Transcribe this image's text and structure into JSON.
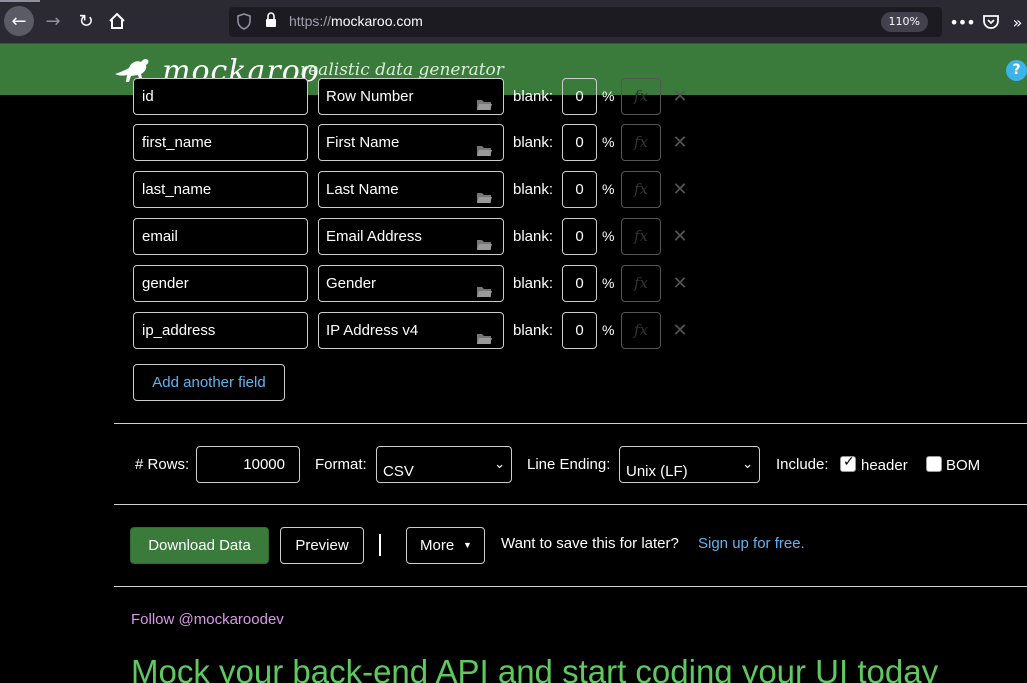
{
  "browser": {
    "url_prefix": "https://",
    "url_host": "mockaroo.com",
    "zoom": "110%"
  },
  "header": {
    "logo_text": "mockaroo",
    "tagline": "realistic data generator",
    "help": "?"
  },
  "fields": [
    {
      "name": "id",
      "type": "Row Number",
      "blank": "0"
    },
    {
      "name": "first_name",
      "type": "First Name",
      "blank": "0"
    },
    {
      "name": "last_name",
      "type": "Last Name",
      "blank": "0"
    },
    {
      "name": "email",
      "type": "Email Address",
      "blank": "0"
    },
    {
      "name": "gender",
      "type": "Gender",
      "blank": "0"
    },
    {
      "name": "ip_address",
      "type": "IP Address v4",
      "blank": "0"
    }
  ],
  "field_labels": {
    "blank": "blank:",
    "percent": "%",
    "fx": "fx",
    "delete": "✕"
  },
  "add_field_label": "Add another field",
  "options": {
    "rows_label": "# Rows:",
    "rows_value": "10000",
    "format_label": "Format:",
    "format_value": "CSV",
    "line_ending_label": "Line Ending:",
    "line_ending_value": "Unix (LF)",
    "include_label": "Include:",
    "header_label": "header",
    "header_checked": true,
    "bom_label": "BOM",
    "bom_checked": false
  },
  "actions": {
    "download_label": "Download Data",
    "preview_label": "Preview",
    "more_label": "More",
    "save_text": "Want to save this for later?",
    "signup_label": "Sign up for free."
  },
  "footer": {
    "follow_label": "Follow @mockaroodev",
    "promo_title": "Mock your back-end API and start coding your UI today"
  },
  "colors": {
    "brand_green": "#3a7a3b",
    "link_blue": "#5fb4f0",
    "promo_green": "#5ec95f"
  }
}
